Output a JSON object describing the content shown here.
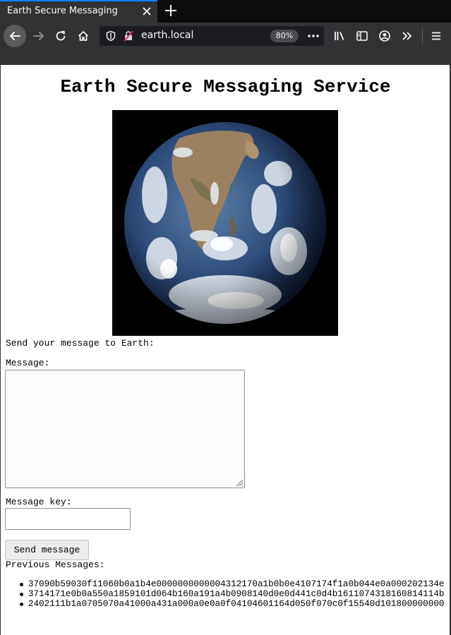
{
  "browser": {
    "tab_title": "Earth Secure Messaging",
    "url": "earth.local",
    "zoom": "80%",
    "colors": {
      "chrome": "#323234",
      "tabbar": "#0c0c0d",
      "accent": "#0a84ff"
    },
    "icons": [
      "close-icon",
      "plus-icon",
      "back-arrow-icon",
      "forward-arrow-icon",
      "reload-icon",
      "home-icon",
      "shield-icon",
      "insecure-lock-icon",
      "more-dots-icon",
      "library-icon",
      "sidebar-icon",
      "account-icon",
      "overflow-chevrons-icon",
      "hamburger-menu-icon"
    ]
  },
  "page": {
    "title": "Earth Secure Messaging Service",
    "intro": "Send your message to Earth:",
    "message_label": "Message:",
    "message_value": "",
    "key_label": "Message key:",
    "key_value": "",
    "send_button": "Send message",
    "previous_heading": "Previous Messages:",
    "previous_messages": [
      "37090b59030f11060b0a1b4e0000000000004312170a1b0b0e4107174f1a0b044e0a000202134e",
      "3714171e0b0a550a1859101d064b160a191a4b0908140d0e0d441c0d4b1611074318160814114b",
      "2402111b1a0705070a41000a431a000a0e0a0f04104601164d050f070c0f15540d101800000000"
    ]
  }
}
